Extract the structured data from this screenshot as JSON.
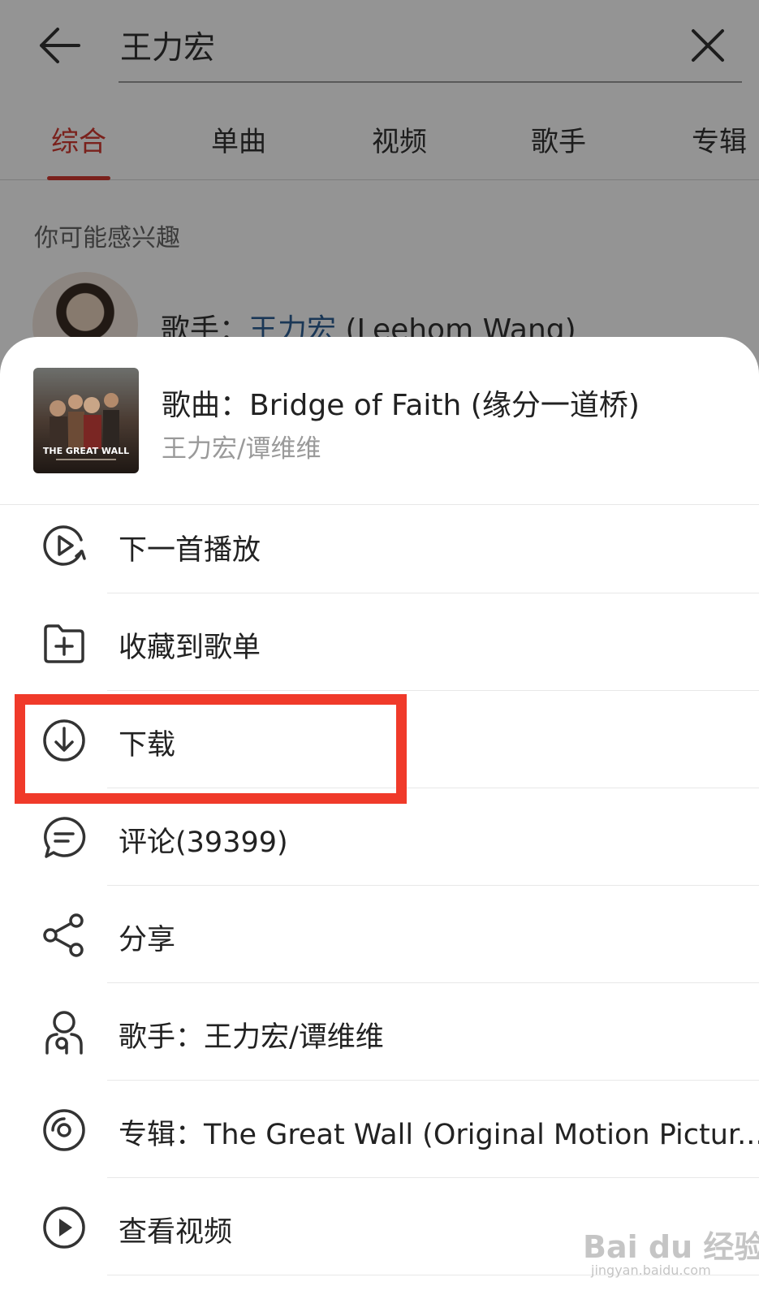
{
  "search": {
    "query": "王力宏"
  },
  "tabs": [
    {
      "label": "综合",
      "active": true
    },
    {
      "label": "单曲",
      "active": false
    },
    {
      "label": "视频",
      "active": false
    },
    {
      "label": "歌手",
      "active": false
    },
    {
      "label": "专辑",
      "active": false
    }
  ],
  "interest": {
    "label": "你可能感兴趣",
    "artist_prefix": "歌手：",
    "artist_name": "王力宏",
    "artist_english": " (Leehom Wang)"
  },
  "sheet": {
    "song_title": "歌曲：Bridge of Faith (缘分一道桥)",
    "song_artist": "王力宏/谭维维",
    "cover_text": "THE GREAT WALL",
    "menu": [
      {
        "label": "下一首播放",
        "icon": "play-next-icon"
      },
      {
        "label": "收藏到歌单",
        "icon": "add-to-playlist-icon"
      },
      {
        "label": "下载",
        "icon": "download-icon"
      },
      {
        "label": "评论(39399)",
        "icon": "comment-icon"
      },
      {
        "label": "分享",
        "icon": "share-icon"
      },
      {
        "label": "歌手：王力宏/谭维维",
        "icon": "artist-icon"
      },
      {
        "label": "专辑：The Great Wall (Original Motion Pictur...",
        "icon": "album-icon"
      },
      {
        "label": "查看视频",
        "icon": "video-icon"
      }
    ]
  },
  "watermark": {
    "brand": "Bai du 经验",
    "url": "jingyan.baidu.com"
  },
  "colors": {
    "accent": "#d33a31",
    "highlight": "#f03a2a",
    "link": "#2d5f95"
  }
}
